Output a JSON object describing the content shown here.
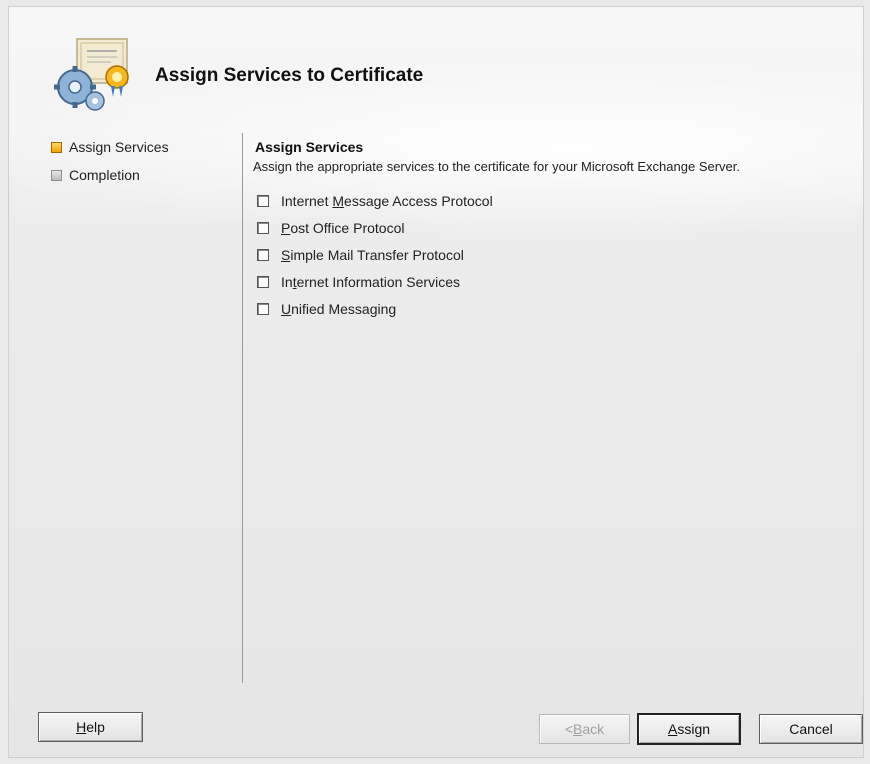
{
  "header": {
    "title": "Assign Services to Certificate",
    "icon": "certificate-gear-icon"
  },
  "steps": [
    {
      "label": "Assign Services",
      "state": "active"
    },
    {
      "label": "Completion",
      "state": "inactive"
    }
  ],
  "section": {
    "title": "Assign Services",
    "description": "Assign the appropriate services to the certificate for your Microsoft Exchange Server."
  },
  "services": [
    {
      "pre": "Internet ",
      "accel": "M",
      "post": "essage Access Protocol",
      "checked": false
    },
    {
      "pre": "",
      "accel": "P",
      "post": "ost Office Protocol",
      "checked": false
    },
    {
      "pre": "",
      "accel": "S",
      "post": "imple Mail Transfer Protocol",
      "checked": false
    },
    {
      "pre": "In",
      "accel": "t",
      "post": "ernet Information Services",
      "checked": false
    },
    {
      "pre": "",
      "accel": "U",
      "post": "nified Messaging",
      "checked": false
    }
  ],
  "buttons": {
    "help": {
      "pre": "",
      "accel": "H",
      "post": "elp"
    },
    "back": {
      "pre": "< ",
      "accel": "B",
      "post": "ack",
      "enabled": false
    },
    "assign": {
      "pre": "",
      "accel": "A",
      "post": "ssign"
    },
    "cancel": {
      "label": "Cancel"
    }
  },
  "colors": {
    "active_step": "#f0a400",
    "inactive_step": "#bcbcbc"
  }
}
